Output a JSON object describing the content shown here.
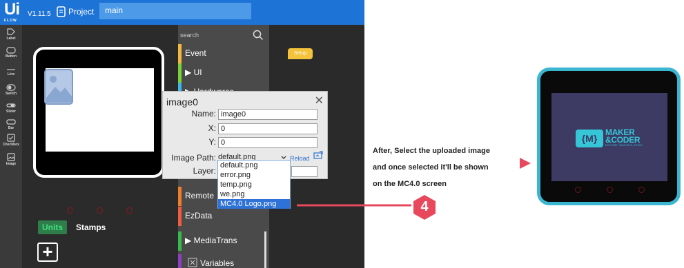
{
  "app": {
    "logo_main": "Ui",
    "logo_sub": "FLOW",
    "version": "V1.11.5",
    "project_label": "Project",
    "project_name": "main"
  },
  "toolbar": {
    "items": [
      "Label",
      "Button",
      "Line",
      "Switch",
      "Slider",
      "Bar",
      "Checkbox",
      "Image"
    ]
  },
  "left_panel": {
    "units_tab": "Units",
    "stamps_tab": "Stamps",
    "add_button": "+"
  },
  "categories": {
    "search_placeholder": "search",
    "items": [
      {
        "label": "Event",
        "color": "#f5b940"
      },
      {
        "label": "▶ UI",
        "color": "#7bd13a"
      },
      {
        "label": "▶ Hardwares",
        "color": "#3fb5e8"
      },
      {
        "label": "Remote",
        "color": "#f07d2c"
      },
      {
        "label": "EzData",
        "color": "#ef5d3b"
      },
      {
        "label": "▶ MediaTrans",
        "color": "#39b84c"
      },
      {
        "label": "Variables",
        "color": "#8c3fbf"
      }
    ]
  },
  "workspace": {
    "setup_block": "Setup"
  },
  "dialog": {
    "title": "image0",
    "close": "✕",
    "name_label": "Name:",
    "name_value": "image0",
    "x_label": "X:",
    "x_value": "0",
    "y_label": "Y:",
    "y_value": "0",
    "path_label": "Image Path:",
    "path_value": "default.png",
    "reload": "Reload",
    "layer_label": "Layer:"
  },
  "dropdown": {
    "options": [
      "default.png",
      "error.png",
      "temp.png",
      "we.png",
      "MC4.0 Logo.png"
    ],
    "selected_index": 4
  },
  "annotation": {
    "step_number": "4",
    "note_lines": [
      "After, Select the uploaded image",
      "and once selected it'll be shown",
      "on the MC4.0 screen"
    ]
  },
  "mc_device": {
    "logo_line1": "MAKER",
    "logo_line2": "&CODER",
    "tagline": "EXPLORE, INNOVATE, EXCEL"
  },
  "colors": {
    "topbar": "#1e73d6",
    "accent_red": "#e8475c",
    "device_border": "#3bb6d1",
    "selected_option": "#2f72d7"
  }
}
